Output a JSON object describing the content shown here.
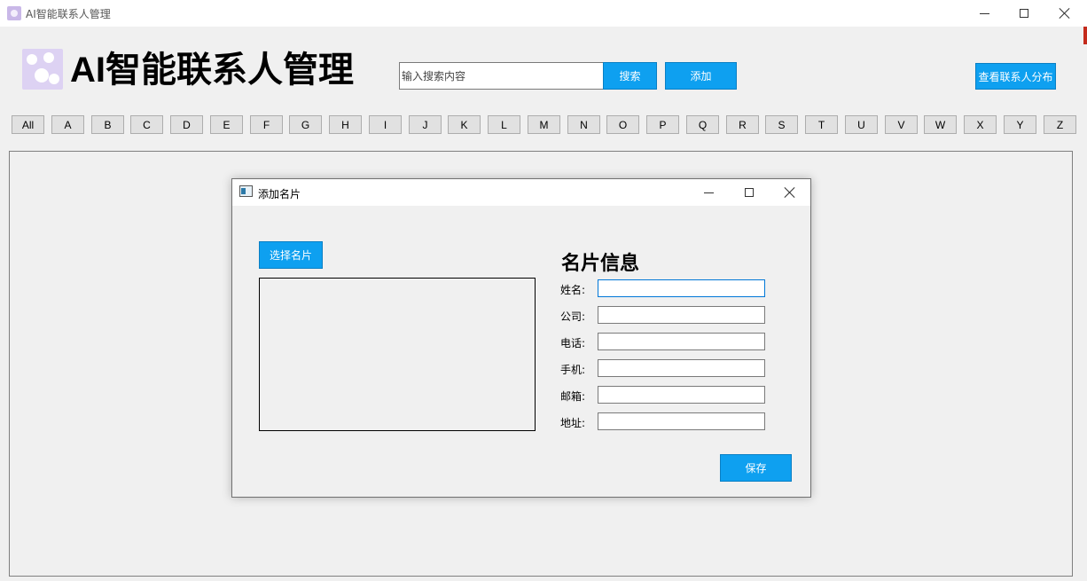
{
  "window": {
    "title": "AI智能联系人管理"
  },
  "header": {
    "app_title": "AI智能联系人管理",
    "search_placeholder": "输入搜索内容",
    "search_label": "搜索",
    "add_label": "添加",
    "distribution_label": "查看联系人分布"
  },
  "letters": [
    "All",
    "A",
    "B",
    "C",
    "D",
    "E",
    "F",
    "G",
    "H",
    "I",
    "J",
    "K",
    "L",
    "M",
    "N",
    "O",
    "P",
    "Q",
    "R",
    "S",
    "T",
    "U",
    "V",
    "W",
    "X",
    "Y",
    "Z"
  ],
  "dialog": {
    "title": "添加名片",
    "choose_label": "选择名片",
    "info_heading": "名片信息",
    "fields": [
      {
        "label": "姓名:",
        "value": ""
      },
      {
        "label": "公司:",
        "value": ""
      },
      {
        "label": "电话:",
        "value": ""
      },
      {
        "label": "手机:",
        "value": ""
      },
      {
        "label": "邮箱:",
        "value": ""
      },
      {
        "label": "地址:",
        "value": ""
      }
    ],
    "save_label": "保存"
  },
  "colors": {
    "accent": "#0ea0f0"
  }
}
